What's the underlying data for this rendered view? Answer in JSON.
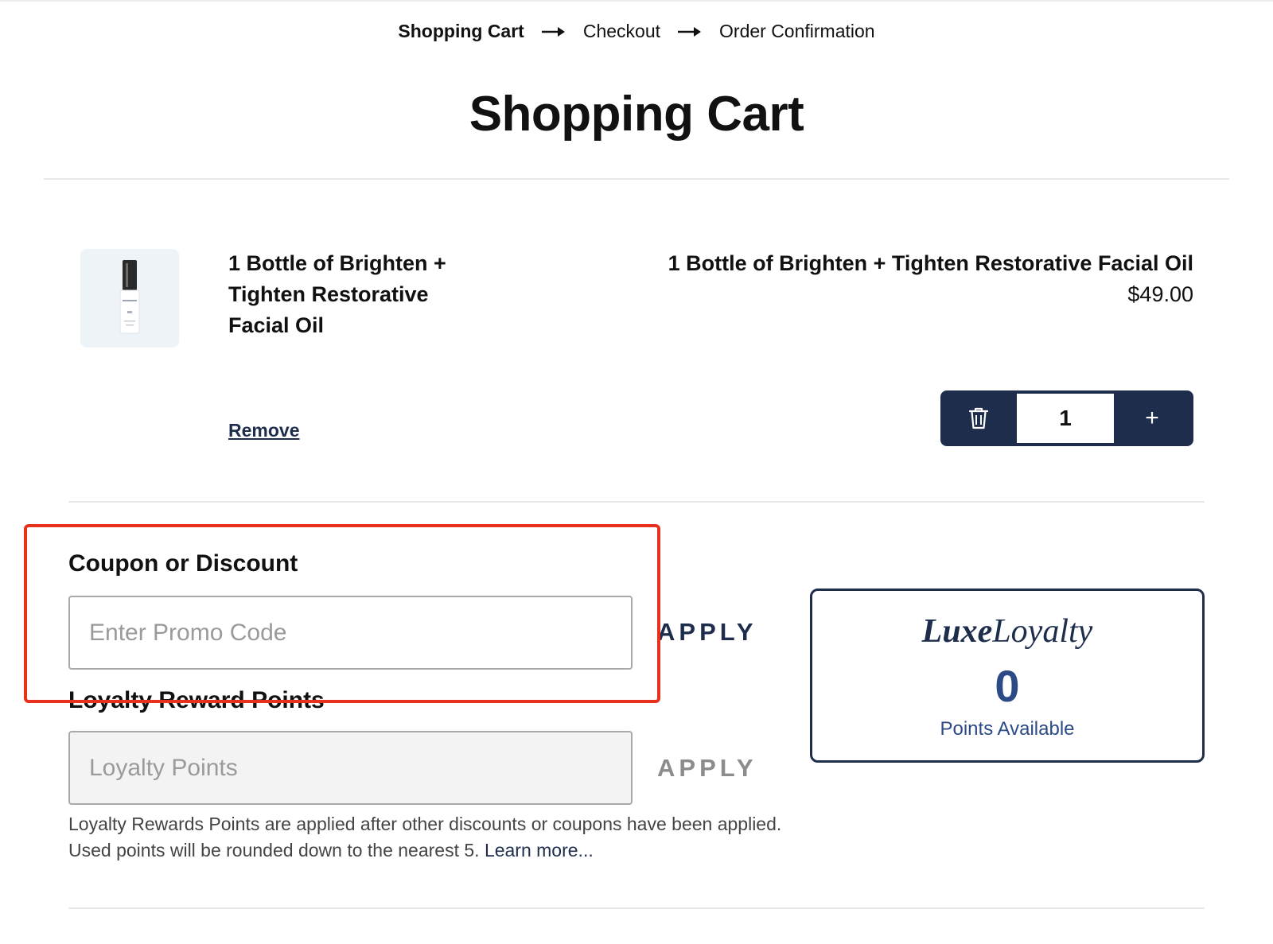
{
  "breadcrumb": {
    "steps": [
      "Shopping Cart",
      "Checkout",
      "Order Confirmation"
    ]
  },
  "page": {
    "title": "Shopping Cart"
  },
  "cart_item": {
    "name_left": "1 Bottle of Brighten + Tighten Restorative Facial Oil",
    "name_right": "1 Bottle of Brighten + Tighten Restorative Facial Oil",
    "price": "$49.00",
    "remove_label": "Remove",
    "quantity": "1",
    "increment_label": "+"
  },
  "coupon": {
    "label": "Coupon or Discount",
    "placeholder": "Enter Promo Code",
    "apply_label": "APPLY"
  },
  "loyalty": {
    "label": "Loyalty Reward Points",
    "placeholder": "Loyalty Points",
    "apply_label": "APPLY",
    "help_line1": "Loyalty Rewards Points are applied after other discounts or coupons have been applied.",
    "help_line2": "Used points will be rounded down to the nearest 5.",
    "learn_more": "Learn more..."
  },
  "loyalty_card": {
    "brand_part1": "Luxe",
    "brand_part2": "Loyalty",
    "points": "0",
    "points_label": "Points Available"
  },
  "colors": {
    "navy": "#1f2d4d",
    "accent_blue": "#2b4a86",
    "highlight_red": "#e8301c",
    "muted_gray": "#8c8c8c"
  }
}
